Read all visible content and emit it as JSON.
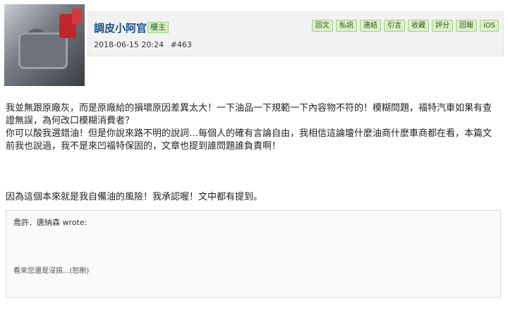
{
  "post": {
    "username": "調皮小阿官",
    "role": "樓主",
    "timestamp": "2018-06-15 20:24",
    "floor": "#463"
  },
  "buttons": [
    "回文",
    "私訊",
    "連結",
    "引言",
    "收藏",
    "評分",
    "回報",
    "iOS"
  ],
  "content": {
    "para1": "我並無跟原廠灰，而是原廠給的損壞原因差異太大！一下油品一下規範一下內容物不符的！模糊問題，福特汽車如果有查證無誤，為何改口模糊消費者？",
    "para2": "你可以酸我選錯油！但是你說來路不明的說詞…每個人的確有言論自由，我相信這論壇什麼油商什麼車商都在看，本篇文前我也說過，我不是來凹福特保固的，文章也提到誰問題誰負責啊！",
    "para3": "因為這個本來就是我自備油的風險！我承認喔！文中都有提到。"
  },
  "quote": {
    "author": "喬許．唐納森 wrote:",
    "body": "看來您還是沒搞...(恕刪)"
  }
}
